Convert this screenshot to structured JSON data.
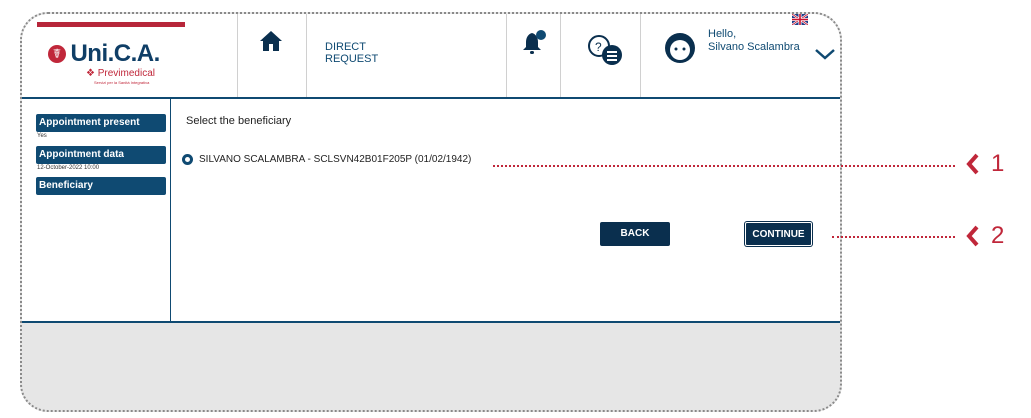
{
  "header": {
    "logo_text": "Uni.C.A.",
    "logo_sub": "Previmedical",
    "logo_sub2": "Servizi per la Sanità Integrativa",
    "direct_request_line1": "DIRECT",
    "direct_request_line2": "REQUEST",
    "user_greeting": "Hello,",
    "user_name": "Silvano Scalambra"
  },
  "sidebar": {
    "steps": [
      {
        "label": "Appointment present",
        "sub": "Yes"
      },
      {
        "label": "Appointment data",
        "sub": "12-October-2022 10:00"
      },
      {
        "label": "Beneficiary",
        "sub": ""
      }
    ]
  },
  "main": {
    "title": "Select the beneficiary",
    "beneficiary_option": "SILVANO SCALAMBRA - SCLSVN42B01F205P (01/02/1942)",
    "back_label": "BACK",
    "continue_label": "CONTINUE"
  },
  "callouts": {
    "first": "1",
    "second": "2"
  },
  "colors": {
    "brand_navy": "#0f4a72",
    "button_dark": "#0a2f4e",
    "brand_red": "#c0273a"
  },
  "icons": [
    "home-icon",
    "bell-icon",
    "chat-icon",
    "user-avatar-icon",
    "chevron-down-icon",
    "uk-flag-icon"
  ]
}
